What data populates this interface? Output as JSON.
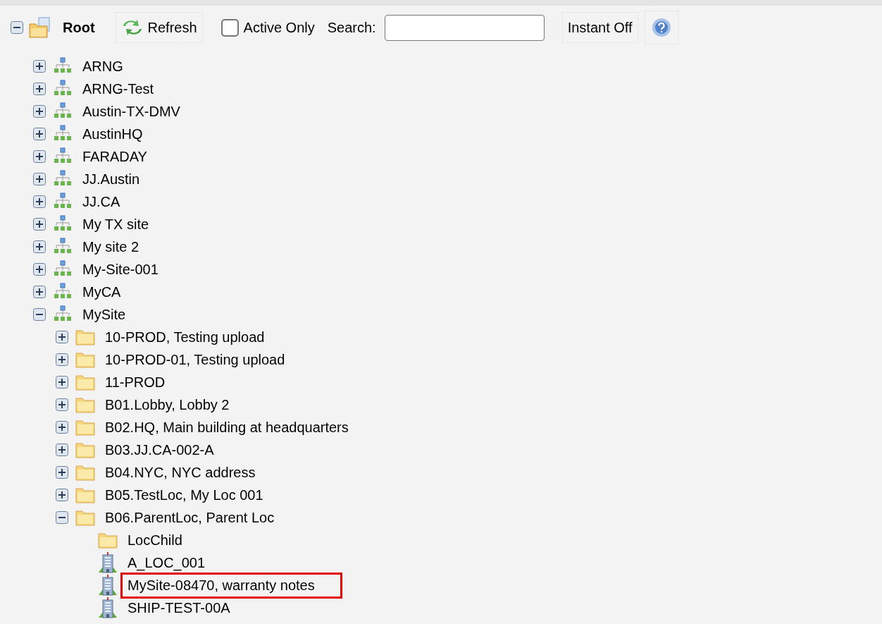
{
  "toolbar": {
    "root": {
      "label": "Root",
      "expanded": true
    },
    "refresh_button": "Refresh",
    "active_only": {
      "label": "Active Only",
      "checked": false
    },
    "search": {
      "label": "Search:"
    },
    "instant_button": "Instant Off"
  },
  "tree": [
    {
      "label": "ARNG",
      "kind": "site",
      "expanded": false
    },
    {
      "label": "ARNG-Test",
      "kind": "site",
      "expanded": false
    },
    {
      "label": "Austin-TX-DMV",
      "kind": "site",
      "expanded": false
    },
    {
      "label": "AustinHQ",
      "kind": "site",
      "expanded": false
    },
    {
      "label": "FARADAY",
      "kind": "site",
      "expanded": false
    },
    {
      "label": "JJ.Austin",
      "kind": "site",
      "expanded": false
    },
    {
      "label": "JJ.CA",
      "kind": "site",
      "expanded": false
    },
    {
      "label": "My TX site",
      "kind": "site",
      "expanded": false
    },
    {
      "label": "My site 2",
      "kind": "site",
      "expanded": false
    },
    {
      "label": "My-Site-001",
      "kind": "site",
      "expanded": false
    },
    {
      "label": "MyCA",
      "kind": "site",
      "expanded": false
    },
    {
      "label": "MySite",
      "kind": "site",
      "expanded": true,
      "children": [
        {
          "label": "10-PROD, Testing upload",
          "kind": "folder",
          "expanded": false
        },
        {
          "label": "10-PROD-01, Testing upload",
          "kind": "folder",
          "expanded": false
        },
        {
          "label": "11-PROD",
          "kind": "folder",
          "expanded": false
        },
        {
          "label": "B01.Lobby, Lobby 2",
          "kind": "folder",
          "expanded": false
        },
        {
          "label": "B02.HQ, Main building at headquarters",
          "kind": "folder",
          "expanded": false
        },
        {
          "label": "B03.JJ.CA-002-A",
          "kind": "folder",
          "expanded": false
        },
        {
          "label": "B04.NYC, NYC address",
          "kind": "folder",
          "expanded": false
        },
        {
          "label": "B05.TestLoc, My Loc 001",
          "kind": "folder",
          "expanded": false
        },
        {
          "label": "B06.ParentLoc, Parent Loc",
          "kind": "folder",
          "expanded": true,
          "children": [
            {
              "label": "LocChild",
              "kind": "folder",
              "highlighted": false
            },
            {
              "label": "A_LOC_001",
              "kind": "building",
              "highlighted": false
            },
            {
              "label": "MySite-08470, warranty notes",
              "kind": "building",
              "highlighted": true
            },
            {
              "label": "SHIP-TEST-00A",
              "kind": "building",
              "highlighted": false
            }
          ]
        }
      ]
    }
  ]
}
